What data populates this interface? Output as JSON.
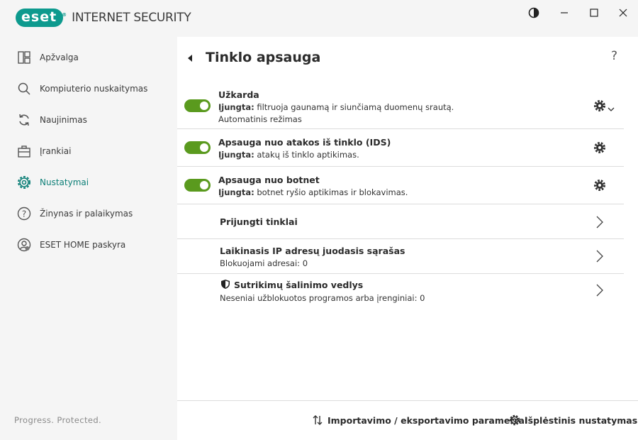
{
  "app": {
    "logo_text": "eset",
    "product_name": "INTERNET SECURITY"
  },
  "sidebar": {
    "items": [
      {
        "label": "Apžvalga",
        "icon": "overview-icon"
      },
      {
        "label": "Kompiuterio nuskaitymas",
        "icon": "search-icon"
      },
      {
        "label": "Naujinimas",
        "icon": "refresh-icon"
      },
      {
        "label": "Įrankiai",
        "icon": "toolbox-icon"
      },
      {
        "label": "Nustatymai",
        "icon": "gear-icon",
        "active": true
      },
      {
        "label": "Žinynas ir palaikymas",
        "icon": "help-icon"
      },
      {
        "label": "ESET HOME paskyra",
        "icon": "account-icon"
      }
    ],
    "tagline": "Progress. Protected."
  },
  "main": {
    "title": "Tinklo apsauga",
    "help": "?",
    "toggles": [
      {
        "title": "Užkarda",
        "status": "Įjungta:",
        "desc": " filtruoja gaunamą ir siunčiamą duomenų srautą.",
        "extra": "Automatinis režimas",
        "enabled": true
      },
      {
        "title": "Apsauga nuo atakos iš tinklo (IDS)",
        "status": "Įjungta:",
        "desc": " atakų iš tinklo aptikimas.",
        "enabled": true
      },
      {
        "title": "Apsauga nuo botnet",
        "status": "Įjungta:",
        "desc": " botnet ryšio aptikimas ir blokavimas.",
        "enabled": true
      }
    ],
    "links": [
      {
        "title": "Prijungti tinklai"
      },
      {
        "title": "Laikinasis IP adresų juodasis sąrašas",
        "desc": "Blokuojami adresai: 0"
      },
      {
        "title": "Sutrikimų šalinimo vedlys",
        "desc": "Neseniai užblokuotos programos arba įrenginiai: 0"
      }
    ]
  },
  "footer": {
    "import_export": "Importavimo / eksportavimo parametrai",
    "advanced": "Išplėstinis nustatymas"
  },
  "colors": {
    "accent": "#0d9a8e",
    "toggle_on": "#5a9a1e"
  }
}
